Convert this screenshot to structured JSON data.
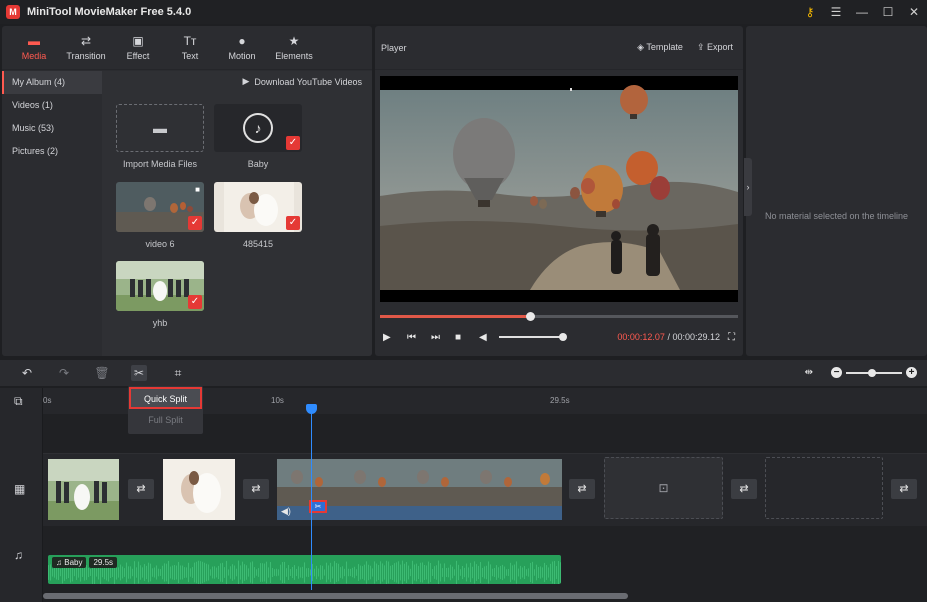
{
  "window": {
    "title": "MiniTool MovieMaker Free 5.4.0",
    "logo_text": "M",
    "controls": [
      "⚷",
      "☰",
      "—",
      "☐",
      "✕"
    ]
  },
  "toolbar": {
    "items": [
      {
        "label": "Media",
        "icon": "folder-icon",
        "glyph": "▬",
        "active": true
      },
      {
        "label": "Transition",
        "icon": "swap-icon",
        "glyph": "⇄"
      },
      {
        "label": "Effect",
        "icon": "effect-icon",
        "glyph": "▣"
      },
      {
        "label": "Text",
        "icon": "text-icon",
        "glyph": "Tт"
      },
      {
        "label": "Motion",
        "icon": "motion-icon",
        "glyph": "●"
      },
      {
        "label": "Elements",
        "icon": "elements-icon",
        "glyph": "★"
      }
    ]
  },
  "sidebar": {
    "items": [
      {
        "label": "My Album (4)",
        "active": true
      },
      {
        "label": "Videos (1)"
      },
      {
        "label": "Music (53)"
      },
      {
        "label": "Pictures (2)"
      }
    ]
  },
  "media": {
    "download_label": "Download YouTube Videos",
    "tiles": [
      {
        "caption": "Import Media Files",
        "type": "import"
      },
      {
        "caption": "Baby",
        "type": "audio"
      },
      {
        "caption": "video 6",
        "type": "video"
      },
      {
        "caption": "485415",
        "type": "image"
      },
      {
        "caption": "yhb",
        "type": "image"
      }
    ]
  },
  "player": {
    "title": "Player",
    "template_label": "Template",
    "export_label": "Export",
    "progress": 0.42,
    "volume": 1.0,
    "current_time": "00:00:12.07",
    "separator": " / ",
    "total_time": "00:00:29.12"
  },
  "properties": {
    "empty_message": "No material selected on the timeline"
  },
  "timeline": {
    "ruler": [
      "0s",
      "10s",
      "29.5s"
    ],
    "audio_clip": {
      "name": "Baby",
      "duration": "29.5s"
    },
    "split_menu": {
      "quick": "Quick Split",
      "full": "Full Split"
    }
  },
  "colors": {
    "accent": "#ff5a50",
    "playhead": "#2f8cff",
    "audio_track": "#27a05a",
    "highlight": "#e53935"
  }
}
